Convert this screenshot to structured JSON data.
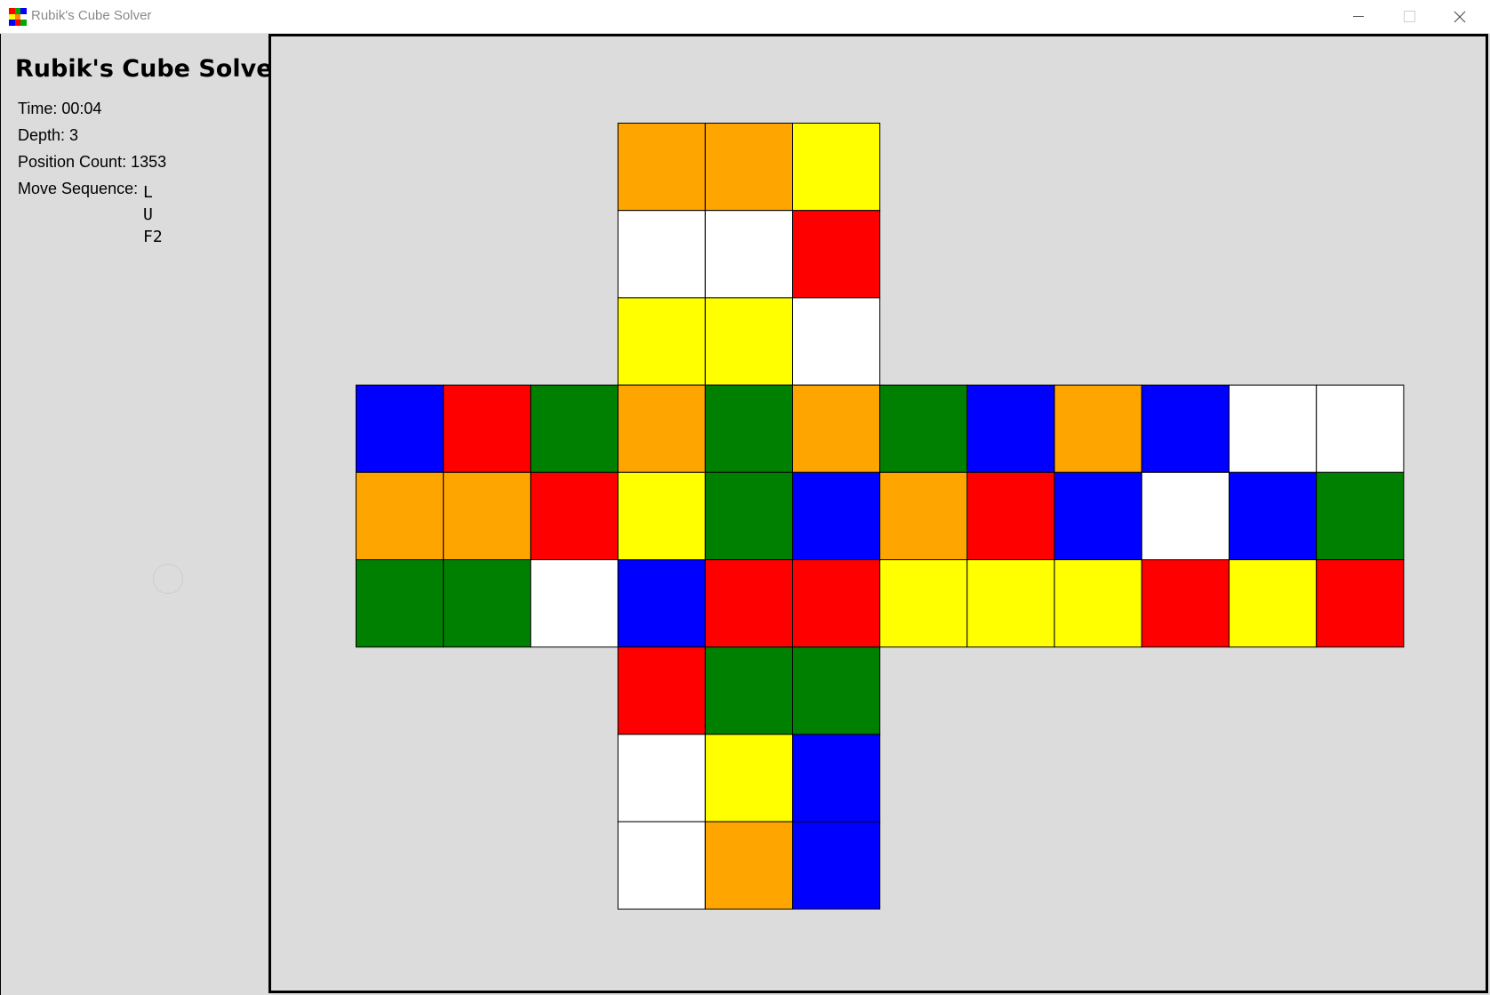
{
  "window": {
    "title": "Rubik's Cube Solver",
    "icon_name": "rubiks-cube-app-icon",
    "icon_colors": [
      "#ff0000",
      "#00aa00",
      "#0000ff",
      "#ffff00",
      "#ff8800",
      "#ffffff",
      "#0000ff",
      "#ff0000",
      "#00aa00"
    ],
    "controls": {
      "minimize_icon": "minimize-icon",
      "maximize_icon": "maximize-icon",
      "close_icon": "close-icon"
    }
  },
  "panel": {
    "title": "Rubik's Cube Solver",
    "time_label": "Time: 00:04",
    "depth_label": "Depth: 3",
    "position_count_label": "Position Count: 1353",
    "move_sequence_label": "Move Sequence:",
    "moves": [
      "L",
      "U",
      "F2"
    ]
  },
  "palette": {
    "O": "#ffa500",
    "Y": "#ffff00",
    "W": "#ffffff",
    "R": "#ff0000",
    "G": "#008000",
    "B": "#0000ff"
  },
  "cube": {
    "up": [
      [
        "O",
        "O",
        "Y"
      ],
      [
        "W",
        "W",
        "R"
      ],
      [
        "Y",
        "Y",
        "W"
      ]
    ],
    "middle_band": [
      [
        "B",
        "R",
        "G",
        "O",
        "G",
        "O",
        "G",
        "B",
        "O",
        "B",
        "W",
        "W"
      ],
      [
        "O",
        "O",
        "R",
        "Y",
        "G",
        "B",
        "O",
        "R",
        "B",
        "W",
        "B",
        "G"
      ],
      [
        "G",
        "G",
        "W",
        "B",
        "R",
        "R",
        "Y",
        "Y",
        "Y",
        "R",
        "Y",
        "R"
      ]
    ],
    "down": [
      [
        "R",
        "G",
        "G"
      ],
      [
        "W",
        "Y",
        "B"
      ],
      [
        "W",
        "O",
        "B"
      ]
    ]
  }
}
